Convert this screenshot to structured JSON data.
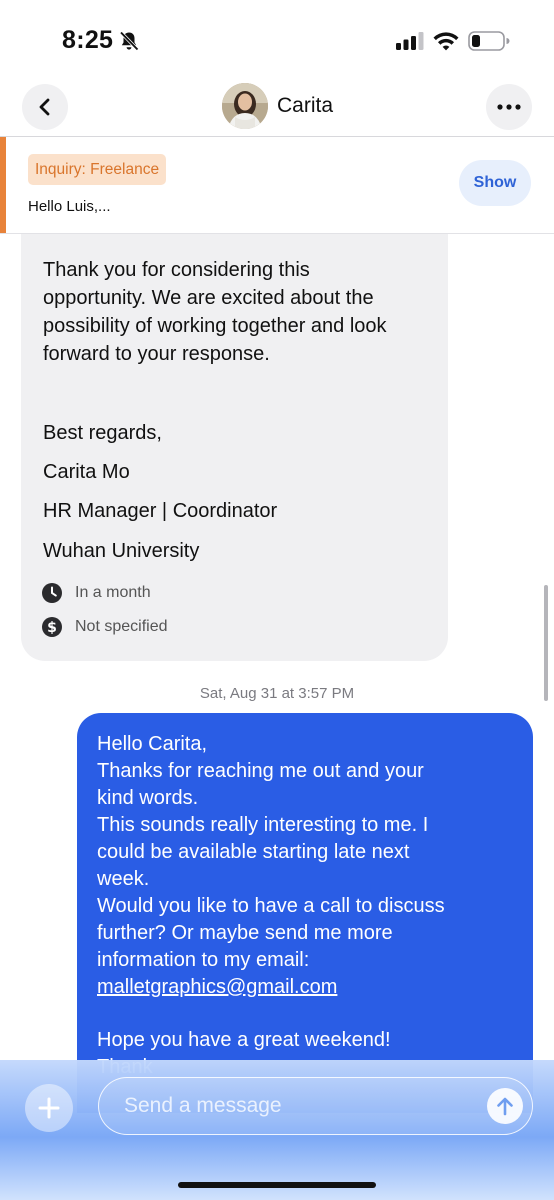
{
  "status_bar": {
    "time": "8:25",
    "icons": [
      "bell-slash-icon",
      "cellular-signal-icon",
      "wifi-icon",
      "battery-icon"
    ]
  },
  "nav": {
    "contact_name": "Carita",
    "back_icon": "chevron-left-icon",
    "more_icon": "more-horizontal-icon"
  },
  "inquiry": {
    "tag": "Inquiry: Freelance",
    "preview": "Hello Luis,...",
    "show_label": "Show",
    "accent_color": "#e8833a"
  },
  "incoming": {
    "paragraph": [
      "Thank you for considering this",
      "opportunity. We are excited about the",
      "possibility of working together and look",
      "forward to your response."
    ],
    "closing": "Best regards,",
    "sender_name": "Carita Mo",
    "sender_title": "HR Manager | Coordinator",
    "sender_org": "Wuhan University",
    "meta": [
      {
        "icon": "clock-icon",
        "text": "In a month"
      },
      {
        "icon": "dollar-icon",
        "text": "Not specified"
      }
    ]
  },
  "timestamp": "Sat, Aug 31 at 3:57 PM",
  "outgoing": {
    "lines": [
      "Hello Carita,",
      "Thanks for reaching me out and your",
      "kind words.",
      "This sounds really interesting to me. I",
      "could be available starting late next",
      "week.",
      "Would you like to have a call to discuss",
      "further? Or maybe send me more",
      "information to my email:"
    ],
    "email": "malletgraphics@gmail.com",
    "after_lines": [
      "Hope you have a great weekend!",
      "Thank"
    ],
    "bubble_color": "#2a5de5"
  },
  "composer": {
    "placeholder": "Send a message",
    "add_icon": "plus-icon",
    "send_icon": "arrow-up-icon"
  }
}
